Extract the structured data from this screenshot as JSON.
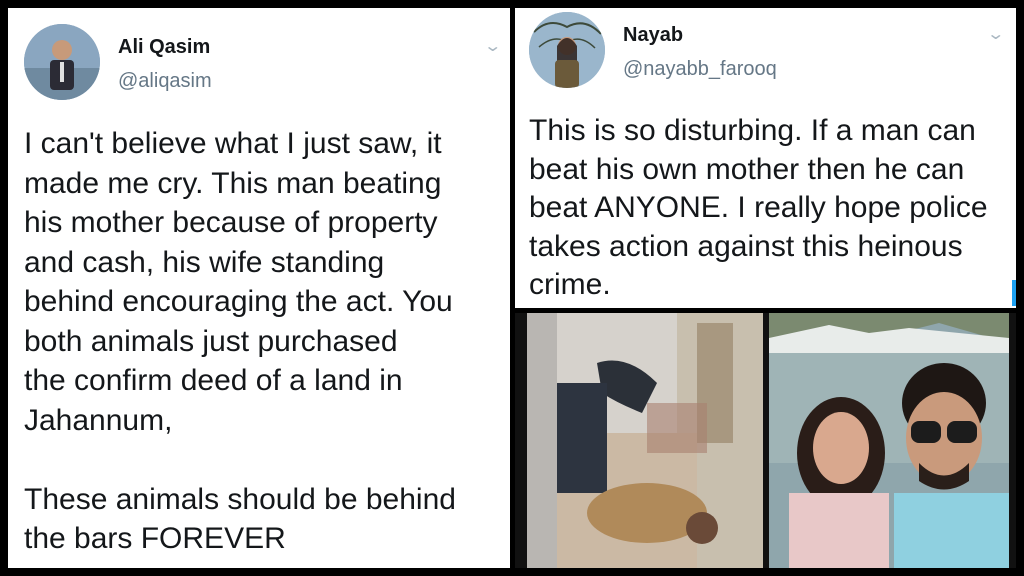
{
  "tweets": [
    {
      "name": "Ali Qasim",
      "handle": "@aliqasim",
      "text": "I can't believe what I just saw, it\nmade me cry. This man beating\nhis mother because of property\nand cash, his wife standing\nbehind encouraging the act. You\nboth animals just purchased\nthe confirm deed of a land in\nJahannum,\n\nThese animals should be behind\nthe bars FOREVER",
      "menu_icon": "chevron-down-icon"
    },
    {
      "name": "Nayab",
      "handle": "@nayabb_farooq",
      "text": "This is so disturbing. If a man can\nbeat his own mother then he can\nbeat ANYONE. I really hope police\ntakes action against this heinous\ncrime.",
      "menu_icon": "chevron-down-icon"
    }
  ],
  "colors": {
    "text": "#14171a",
    "secondary": "#657786",
    "accent": "#1da1f2",
    "divider": "#000000"
  }
}
